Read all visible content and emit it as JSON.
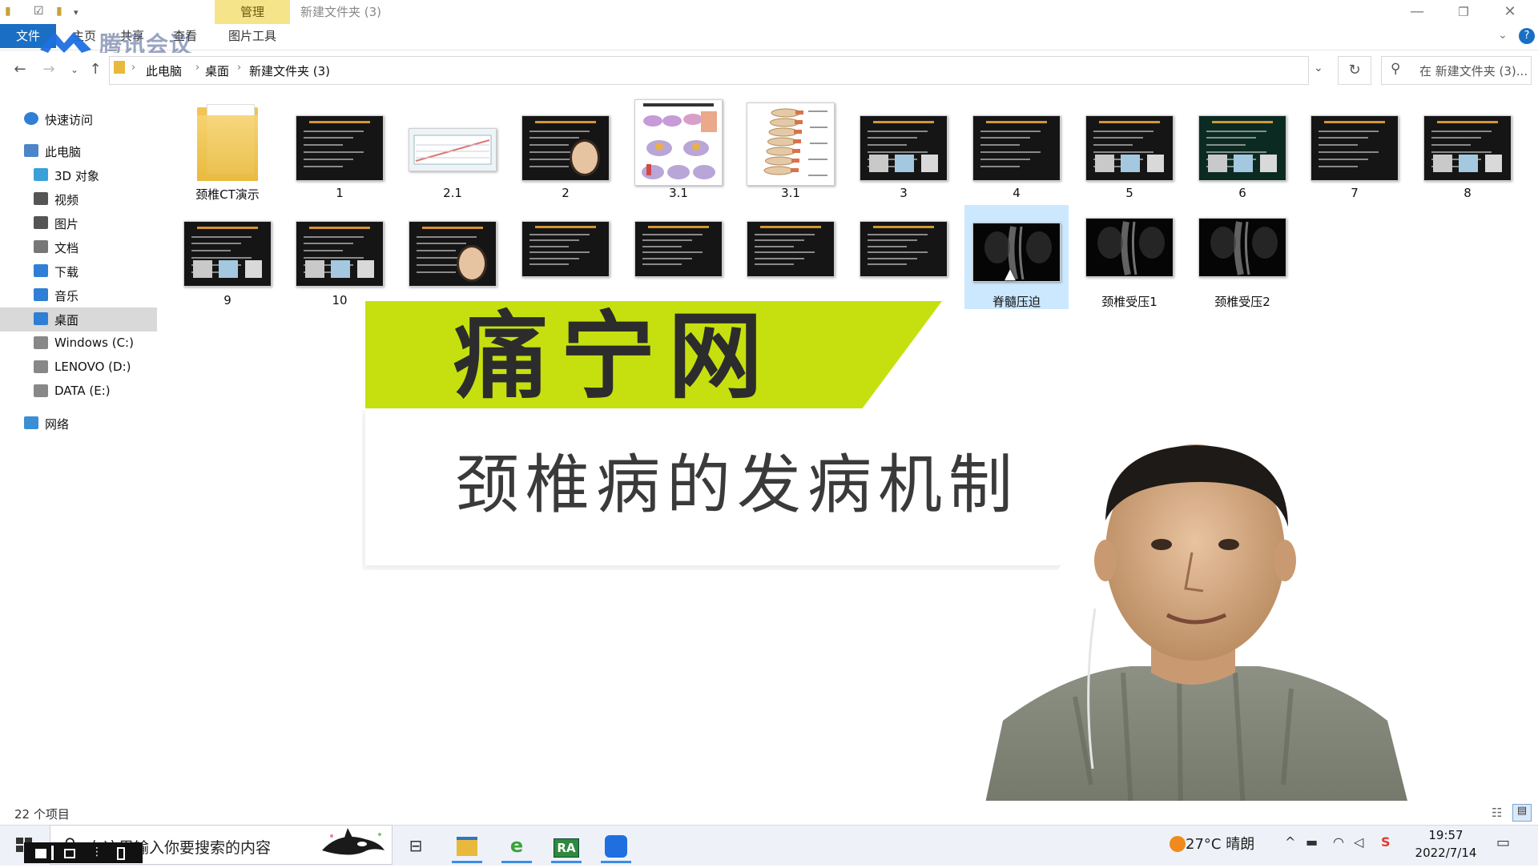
{
  "window": {
    "title": "新建文件夹 (3)",
    "tab_manage": "管理",
    "tab_file": "文件",
    "tab_home": "主页",
    "tab_share": "共享",
    "tab_view": "查看",
    "tab_picture_tools": "图片工具",
    "overlay_app": "腾讯会议"
  },
  "address": {
    "crumbs": [
      "此电脑",
      "桌面",
      "新建文件夹 (3)"
    ],
    "search_placeholder": "在 新建文件夹 (3)..."
  },
  "nav": [
    {
      "label": "快速访问",
      "icon": "star-icon"
    },
    {
      "label": "此电脑",
      "icon": "computer-icon"
    },
    {
      "label": "3D 对象",
      "icon": "cube-icon"
    },
    {
      "label": "视频",
      "icon": "video-icon"
    },
    {
      "label": "图片",
      "icon": "picture-icon"
    },
    {
      "label": "文档",
      "icon": "document-icon"
    },
    {
      "label": "下载",
      "icon": "download-icon"
    },
    {
      "label": "音乐",
      "icon": "music-icon"
    },
    {
      "label": "桌面",
      "icon": "desktop-icon",
      "selected": true
    },
    {
      "label": "Windows (C:)",
      "icon": "drive-icon"
    },
    {
      "label": "LENOVO (D:)",
      "icon": "drive-icon"
    },
    {
      "label": "DATA (E:)",
      "icon": "drive-icon"
    },
    {
      "label": "网络",
      "icon": "network-icon"
    }
  ],
  "files": [
    {
      "name": "颈椎CT演示",
      "kind": "folder"
    },
    {
      "name": "1",
      "kind": "slide"
    },
    {
      "name": "2.1",
      "kind": "chart"
    },
    {
      "name": "2",
      "kind": "slide-avatar"
    },
    {
      "name": "3.1",
      "kind": "anatomy"
    },
    {
      "name": "3.1",
      "kind": "spine"
    },
    {
      "name": "3",
      "kind": "slide-img"
    },
    {
      "name": "4",
      "kind": "slide"
    },
    {
      "name": "5",
      "kind": "slide-img"
    },
    {
      "name": "6",
      "kind": "slide-green"
    },
    {
      "name": "7",
      "kind": "slide"
    },
    {
      "name": "8",
      "kind": "slide-img"
    },
    {
      "name": "9",
      "kind": "slide-img"
    },
    {
      "name": "10",
      "kind": "slide-img"
    },
    {
      "name": "",
      "kind": "slide-avatar"
    },
    {
      "name": "",
      "kind": "slide"
    },
    {
      "name": "",
      "kind": "slide"
    },
    {
      "name": "",
      "kind": "slide"
    },
    {
      "name": "",
      "kind": "slide"
    },
    {
      "name": "脊髓压迫",
      "kind": "xray",
      "selected": true
    },
    {
      "name": "颈椎受压1",
      "kind": "xray"
    },
    {
      "name": "颈椎受压2",
      "kind": "xray"
    }
  ],
  "banner": {
    "title": "痛宁网",
    "subtitle": "颈椎病的发病机制"
  },
  "status": {
    "count": "22 个项目"
  },
  "taskbar": {
    "search_text": "在这里输入你要搜索的内容",
    "weather": "27°C 晴朗",
    "time": "19:57",
    "date": "2022/7/14"
  },
  "colors": {
    "accent": "#1a6fc4",
    "banner_green": "#c6e00f",
    "manage_tab": "#f6e48b",
    "selection": "#cce8ff"
  }
}
